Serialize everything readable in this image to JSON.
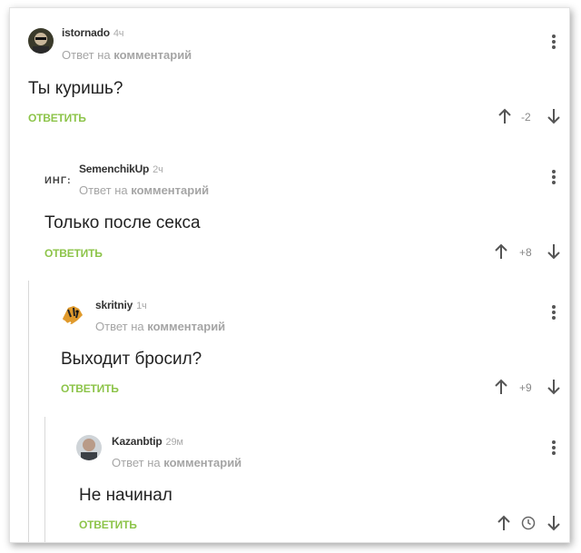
{
  "comments": [
    {
      "username": "istornado",
      "time": "4ч",
      "reply_prefix": "Ответ на",
      "reply_target": "комментарий",
      "text": "Ты куришь?",
      "reply_label": "ОТВЕТИТЬ",
      "rating": "-2"
    },
    {
      "username": "SemenchikUp",
      "time": "2ч",
      "avatar_text": "ИНГ:",
      "reply_prefix": "Ответ на",
      "reply_target": "комментарий",
      "text": "Только после секса",
      "reply_label": "ОТВЕТИТЬ",
      "rating": "+8"
    },
    {
      "username": "skritniy",
      "time": "1ч",
      "reply_prefix": "Ответ на",
      "reply_target": "комментарий",
      "text": "Выходит бросил?",
      "reply_label": "ОТВЕТИТЬ",
      "rating": "+9"
    },
    {
      "username": "Kazanbtip",
      "time": "29м",
      "reply_prefix": "Ответ на",
      "reply_target": "комментарий",
      "text": "Не начинал",
      "reply_label": "ОТВЕТИТЬ",
      "rating_icon": "clock-icon"
    }
  ],
  "colors": {
    "reply_green": "#8dc44a",
    "text": "#222222",
    "muted": "#a5a5a5"
  }
}
